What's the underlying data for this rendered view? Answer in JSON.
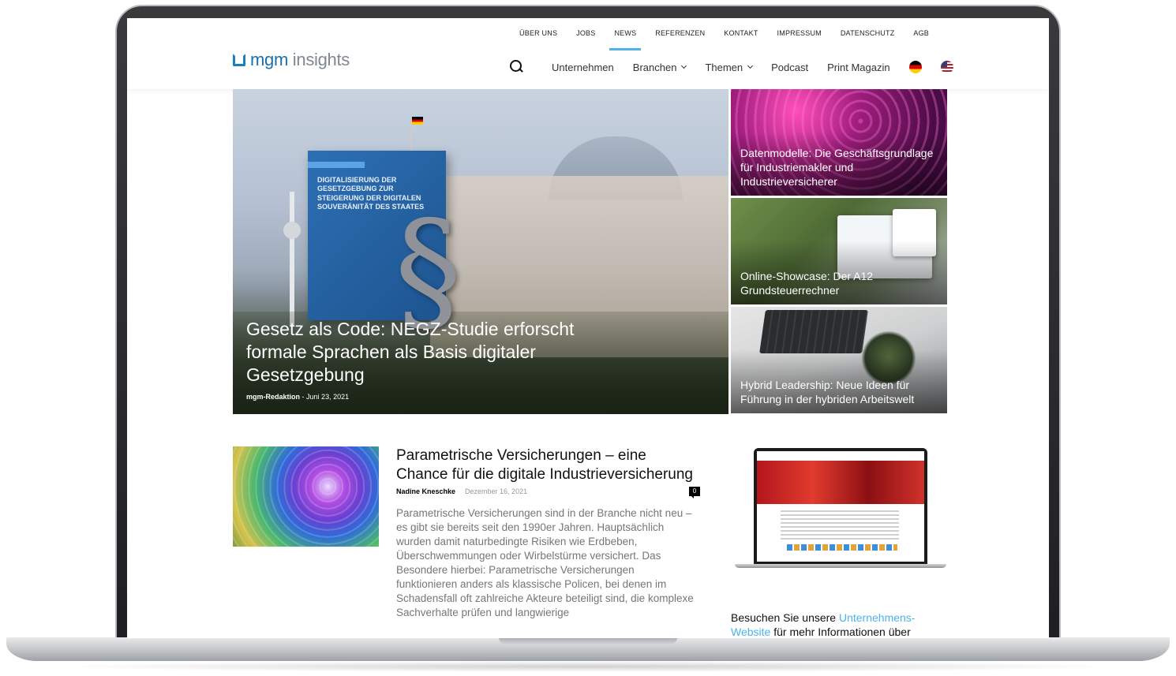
{
  "topnav": {
    "items": [
      "ÜBER UNS",
      "JOBS",
      "NEWS",
      "REFERENZEN",
      "KONTAKT",
      "IMPRESSUM",
      "DATENSCHUTZ",
      "AGB"
    ]
  },
  "logo": {
    "part1": "mgm",
    "part2": " insights"
  },
  "mainnav": {
    "items": [
      {
        "label": "Unternehmen"
      },
      {
        "label": "Branchen"
      },
      {
        "label": "Themen"
      },
      {
        "label": "Podcast"
      },
      {
        "label": "Print Magazin"
      }
    ]
  },
  "hero": {
    "title": "Gesetz als Code: NEGZ-Studie erforscht formale Sprachen als Basis digitaler Gesetzgebung",
    "author": "mgm-Redaktion",
    "separator": "-",
    "date": "Juni 23, 2021",
    "book_title": "DIGITALISIERUNG DER GESETZGEBUNG ZUR STEIGERUNG DER DIGITALEN SOUVERÄNITÄT DES STAATES",
    "paragraph_glyph": "§"
  },
  "tiles": [
    {
      "title": "Datenmodelle: Die Geschäftsgrundlage für Industriemakler und Industrieversicherer"
    },
    {
      "title": "Online-Showcase: Der A12 Grundsteuerrechner"
    },
    {
      "title": "Hybrid Leadership: Neue Ideen für Führung in der hybriden Arbeitswelt"
    }
  ],
  "article": {
    "title": "Parametrische Versicherungen – eine Chance für die digitale Industrieversicherung",
    "author": "Nadine Kneschke",
    "date": "Dezember 16, 2021",
    "comments": "0",
    "excerpt": "Parametrische Versicherungen sind in der Branche nicht neu – es gibt sie bereits seit den 1990er Jahren. Hauptsächlich wurden damit naturbedingte Risiken wie Erdbeben, Überschwemmungen oder Wirbelstürme versichert. Das Besondere hierbei: Parametrische Versicherungen funktionieren anders als klassische Policen, bei denen im Schadensfall oft zahlreiche Akteure beteiligt sind, die komplexe Sachverhalte prüfen und langwierige"
  },
  "sidebar": {
    "text_before": "Besuchen Sie unsere ",
    "link": "Unternehmens-Website",
    "text_after": " für mehr Informationen über"
  },
  "colors": {
    "accent": "#4db2ec",
    "logo": "#1a6fae"
  }
}
